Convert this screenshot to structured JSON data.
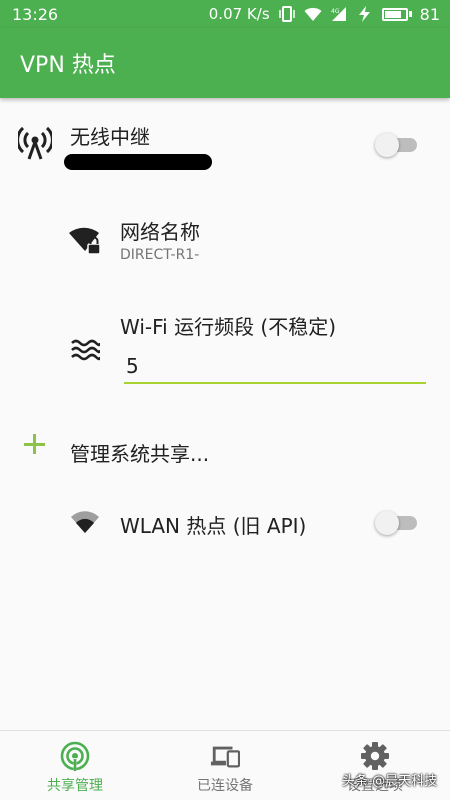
{
  "status_bar": {
    "time": "13:26",
    "net_speed": "0.07 K/s",
    "battery": "81",
    "battery_level": 0.81
  },
  "app_bar": {
    "title": "VPN 热点"
  },
  "wireless_repeater": {
    "title": "无线中继",
    "enabled": false
  },
  "network_name": {
    "title": "网络名称",
    "value": "DIRECT-R1-"
  },
  "wifi_band": {
    "title": "Wi-Fi 运行频段 (不稳定)",
    "value": "5"
  },
  "manage_sharing": {
    "label": "管理系统共享..."
  },
  "wlan_hotspot": {
    "title": "WLAN 热点 (旧 API)",
    "enabled": false
  },
  "bottom_nav": {
    "items": [
      {
        "label": "共享管理",
        "icon": "hotspot-icon",
        "active": true
      },
      {
        "label": "已连设备",
        "icon": "devices-icon",
        "active": false
      },
      {
        "label": "设置选项",
        "icon": "gear-icon",
        "active": false
      }
    ]
  },
  "watermark": "头条 @晨天科技",
  "colors": {
    "primary": "#4caf50",
    "accent": "#a8d22d",
    "plus": "#8bc34a"
  }
}
